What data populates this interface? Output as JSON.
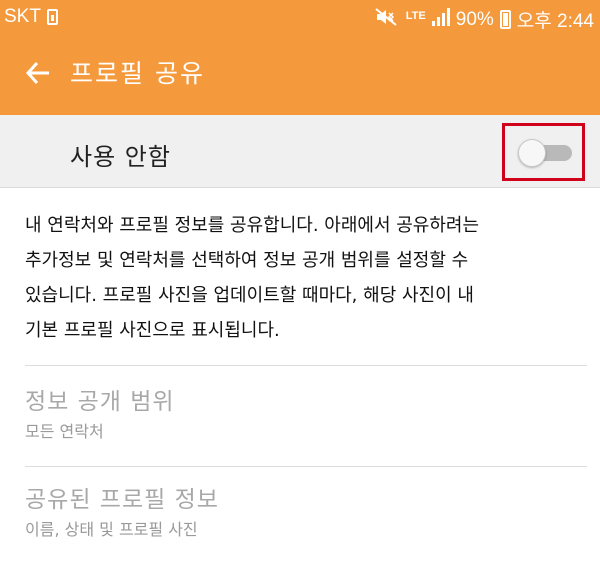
{
  "status_bar": {
    "carrier": "SKT",
    "network_type": "LTE",
    "battery_percent": "90%",
    "time": "오후 2:44",
    "icons": [
      "sim-card-icon",
      "mute-icon",
      "lte-signal-icon",
      "battery-icon"
    ]
  },
  "app_bar": {
    "title": "프로필 공유",
    "back_icon": "arrow-left-icon"
  },
  "master_switch": {
    "label": "사용 안함",
    "enabled": false
  },
  "description": {
    "lines": [
      "내 연락처와 프로필 정보를 공유합니다. 아래에서 공유하려는",
      "추가정보 및 연락처를 선택하여 정보 공개 범위를 설정할 수",
      "있습니다. 프로필 사진을 업데이트할 때마다, 해당 사진이 내",
      "기본 프로필 사진으로 표시됩니다."
    ]
  },
  "settings": [
    {
      "title": "정보 공개 범위",
      "summary": "모든 연락처",
      "enabled": false
    },
    {
      "title": "공유된 프로필 정보",
      "summary": "이름, 상태 및 프로필 사진",
      "enabled": false
    }
  ],
  "colors": {
    "accent": "#f59a3c",
    "switch_row_bg": "#f0f0f0",
    "highlight_border": "#d0021b",
    "disabled_text": "#a8a8a8"
  }
}
